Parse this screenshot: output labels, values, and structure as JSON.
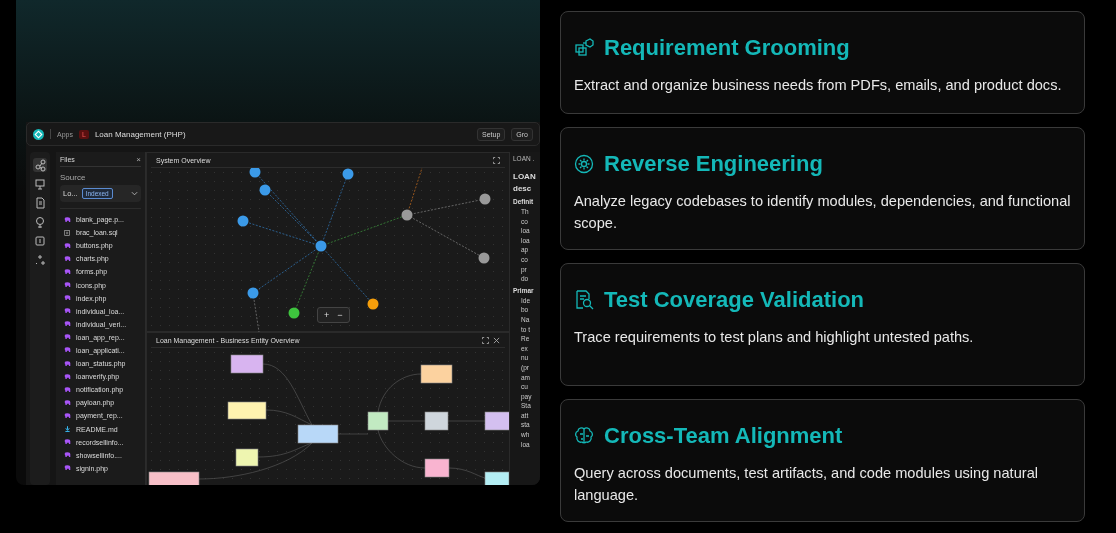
{
  "preview": {
    "topbar": {
      "apps": "Apps",
      "app_badge": "L",
      "app_title": "Loan Management (PHP)",
      "actions": [
        "Setup",
        "Gro"
      ]
    },
    "rail": [
      {
        "kind": "graph",
        "selected": true
      },
      {
        "kind": "monitor",
        "selected": false
      },
      {
        "kind": "document",
        "selected": false
      },
      {
        "kind": "tree",
        "selected": false
      },
      {
        "kind": "number",
        "selected": false
      },
      {
        "kind": "sparkle",
        "selected": false
      }
    ],
    "files_panel": {
      "title": "Files",
      "close": "×",
      "source_label": "Source",
      "source_value": "Lo...",
      "source_badge": "Indexed",
      "files": [
        {
          "name": "blank_page.p...",
          "kind": "php"
        },
        {
          "name": "brac_loan.sql",
          "kind": "sql"
        },
        {
          "name": "buttons.php",
          "kind": "php"
        },
        {
          "name": "charts.php",
          "kind": "php"
        },
        {
          "name": "forms.php",
          "kind": "php"
        },
        {
          "name": "icons.php",
          "kind": "php"
        },
        {
          "name": "index.php",
          "kind": "php"
        },
        {
          "name": "individual_loa...",
          "kind": "php"
        },
        {
          "name": "individual_veri...",
          "kind": "php"
        },
        {
          "name": "loan_app_rep...",
          "kind": "php"
        },
        {
          "name": "loan_applicati...",
          "kind": "php"
        },
        {
          "name": "loan_status.php",
          "kind": "php"
        },
        {
          "name": "loanverify.php",
          "kind": "php"
        },
        {
          "name": "notification.php",
          "kind": "php"
        },
        {
          "name": "payloan.php",
          "kind": "php"
        },
        {
          "name": "payment_rep...",
          "kind": "php"
        },
        {
          "name": "README.md",
          "kind": "md"
        },
        {
          "name": "recordsellinfo...",
          "kind": "php"
        },
        {
          "name": "showsellinfo....",
          "kind": "php"
        },
        {
          "name": "signin.php",
          "kind": "php"
        }
      ]
    },
    "system_overview": {
      "title": "System Overview",
      "zoom_controls": [
        "+",
        "−"
      ]
    },
    "entity_overview": {
      "title": "Loan Management - Business Entity Overview"
    },
    "details": {
      "header": "LOAN .",
      "heading": [
        "LOAN",
        "desc"
      ],
      "section_1": "Definit",
      "lines_1": [
        "Th",
        "co",
        "loa",
        "loa",
        "ap",
        "co",
        "pr",
        "do"
      ],
      "section_2": "Primar",
      "lines_2": [
        "Ide",
        "bo",
        "Na",
        "to t",
        "Re",
        "ex",
        "nu",
        "(pr",
        "am",
        "cu",
        "pay",
        "Sta",
        "att",
        "sta",
        "wh",
        "loa"
      ]
    }
  },
  "features": [
    {
      "kind": "cubes",
      "title": "Requirement Grooming",
      "description": "Extract and organize business needs from PDFs, emails, and product docs."
    },
    {
      "kind": "gear",
      "title": "Reverse Engineering",
      "description": "Analyze legacy codebases to identify modules, dependencies, and functional scope."
    },
    {
      "kind": "search-doc",
      "title": "Test Coverage Validation",
      "description": "Trace requirements to test plans and highlight untested paths."
    },
    {
      "kind": "brain",
      "title": "Cross-Team Alignment",
      "description": "Query across documents, test artifacts, and code modules using natural language."
    }
  ]
}
